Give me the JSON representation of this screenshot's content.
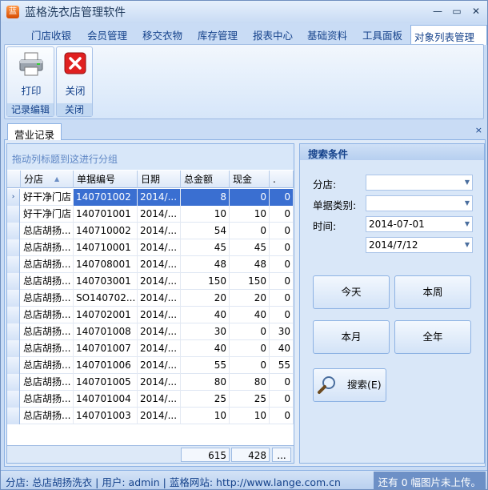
{
  "window": {
    "title": "蓝格洗衣店管理软件",
    "minimize": "—",
    "restore": "▭",
    "close": "✕"
  },
  "menu": [
    "门店收银",
    "会员管理",
    "移交衣物",
    "库存管理",
    "报表中心",
    "基础资料",
    "工具面板",
    "对象列表管理"
  ],
  "ribbon": {
    "groups": [
      {
        "caption": "记录编辑",
        "button": "打印"
      },
      {
        "caption": "关闭",
        "button": "关闭"
      }
    ]
  },
  "doc_tab": {
    "label": "营业记录",
    "close": "×"
  },
  "grid": {
    "group_hint": "拖动列标题到这进行分组",
    "columns": [
      "分店",
      "单据编号",
      "日期",
      "总金额",
      "现金",
      "."
    ],
    "rows": [
      [
        "好干净门店",
        "140701002",
        "2014/...",
        "8",
        "0",
        "0"
      ],
      [
        "好干净门店",
        "140701001",
        "2014/...",
        "10",
        "10",
        "0"
      ],
      [
        "总店胡扬...",
        "140710002",
        "2014/...",
        "54",
        "0",
        "0"
      ],
      [
        "总店胡扬...",
        "140710001",
        "2014/...",
        "45",
        "45",
        "0"
      ],
      [
        "总店胡扬...",
        "140708001",
        "2014/...",
        "48",
        "48",
        "0"
      ],
      [
        "总店胡扬...",
        "140703001",
        "2014/...",
        "150",
        "150",
        "0"
      ],
      [
        "总店胡扬...",
        "SO140702...",
        "2014/...",
        "20",
        "20",
        "0"
      ],
      [
        "总店胡扬...",
        "140702001",
        "2014/...",
        "40",
        "40",
        "0"
      ],
      [
        "总店胡扬...",
        "140701008",
        "2014/...",
        "30",
        "0",
        "30"
      ],
      [
        "总店胡扬...",
        "140701007",
        "2014/...",
        "40",
        "0",
        "40"
      ],
      [
        "总店胡扬...",
        "140701006",
        "2014/...",
        "55",
        "0",
        "55"
      ],
      [
        "总店胡扬...",
        "140701005",
        "2014/...",
        "80",
        "80",
        "0"
      ],
      [
        "总店胡扬...",
        "140701004",
        "2014/...",
        "25",
        "25",
        "0"
      ],
      [
        "总店胡扬...",
        "140701003",
        "2014/...",
        "10",
        "10",
        "0"
      ]
    ],
    "footer": {
      "total": "615",
      "cash": "428",
      "more": "..."
    }
  },
  "search": {
    "title": "搜索条件",
    "branch_label": "分店:",
    "branch_value": "",
    "type_label": "单据类别:",
    "type_value": "",
    "time_label": "时间:",
    "date_from": "2014-07-01",
    "date_to": "2014/7/12",
    "btn_today": "今天",
    "btn_week": "本周",
    "btn_month": "本月",
    "btn_year": "全年",
    "btn_search": "搜索(E)"
  },
  "status": {
    "left": "分店: 总店胡扬洗衣  | 用户: admin  |  蓝格网站: http://www.lange.com.cn",
    "right": "还有 0 幅图片未上传。"
  },
  "colors": {
    "selected_row": "#3a6fd1",
    "menu_text": "#15428b",
    "close_icon": "#e02020"
  }
}
